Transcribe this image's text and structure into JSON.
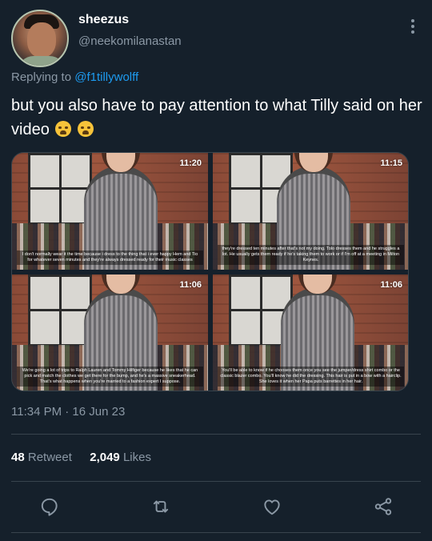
{
  "user": {
    "display_name": "sheezus",
    "handle": "@neekomilanastan",
    "avatar_icon": "profile-photo-icon"
  },
  "reply": {
    "prefix": "Replying to",
    "mention": "@f1tillywolff"
  },
  "tweet": {
    "text": "but you also have to pay attention to what Tilly said on her video",
    "emoji": [
      "loudly-crying-face",
      "loudly-crying-face"
    ]
  },
  "media": {
    "frames": [
      {
        "time": "11:20",
        "caption": "I don't normally wear it the time because i dress to the thing that i ever happy Hem and Tio for whatever seven minutes and they're always dressed ready for their music classes"
      },
      {
        "time": "11:15",
        "caption": "they're dressed ten minutes after that's not my doing. Tolo dresses them and he struggles a lot. He usually gets them ready if he's taking them to work or if I'm off at a meeting in Milton Keynes."
      },
      {
        "time": "11:06",
        "caption": "We're going a lot of trips to Ralph Lauren and Tommy Hilfiger because he likes that he can pick and match the clothes we get there for the bump, and he's a massive sneakerhead. That's what happens when you're married to a fashion expert I suppose."
      },
      {
        "time": "11:06",
        "caption": "You'll be able to know if he chooses them once you see the jumper/dress shirt combo or the classic blazer combo. You'll know he did the dressing. This hair is put in a bow with a hairclip. She loves it when her Papa puts barrettes in her hair."
      }
    ]
  },
  "timestamp": "11:34 PM · 16 Jun 23",
  "stats": {
    "retweets_count": "48",
    "retweets_label": "Retweet",
    "likes_count": "2,049",
    "likes_label": "Likes"
  },
  "actions": [
    "reply-icon",
    "retweet-icon",
    "like-icon",
    "share-icon"
  ],
  "colors": {
    "background": "#15202b",
    "text_primary": "#ffffff",
    "text_secondary": "#8b98a5",
    "link": "#1d9bf0",
    "divider": "#38444d"
  }
}
